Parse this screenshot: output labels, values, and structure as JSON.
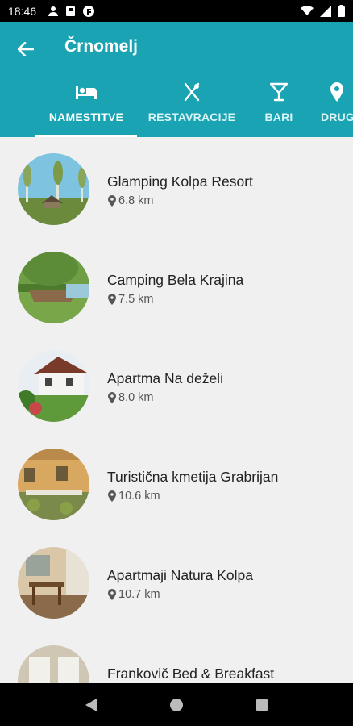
{
  "status_bar": {
    "time": "18:46"
  },
  "header": {
    "title": "Črnomelj"
  },
  "tabs": [
    {
      "label": "NAMESTITVE",
      "icon": "bed-icon"
    },
    {
      "label": "RESTAVRACIJE",
      "icon": "fork-knife-icon"
    },
    {
      "label": "BARI",
      "icon": "cocktail-icon"
    },
    {
      "label": "DRUG",
      "icon": "location-pin-icon"
    }
  ],
  "items": [
    {
      "name": "Glamping Kolpa Resort",
      "distance": "6.8 km"
    },
    {
      "name": "Camping Bela Krajina",
      "distance": "7.5 km"
    },
    {
      "name": "Apartma Na deželi",
      "distance": "8.0 km"
    },
    {
      "name": "Turistična kmetija Grabrijan",
      "distance": "10.6 km"
    },
    {
      "name": "Apartmaji Natura Kolpa",
      "distance": "10.7 km"
    },
    {
      "name": "Frankovič Bed & Breakfast",
      "distance": ""
    }
  ],
  "colors": {
    "primary": "#1aa3b3",
    "background": "#f0f0f0"
  }
}
